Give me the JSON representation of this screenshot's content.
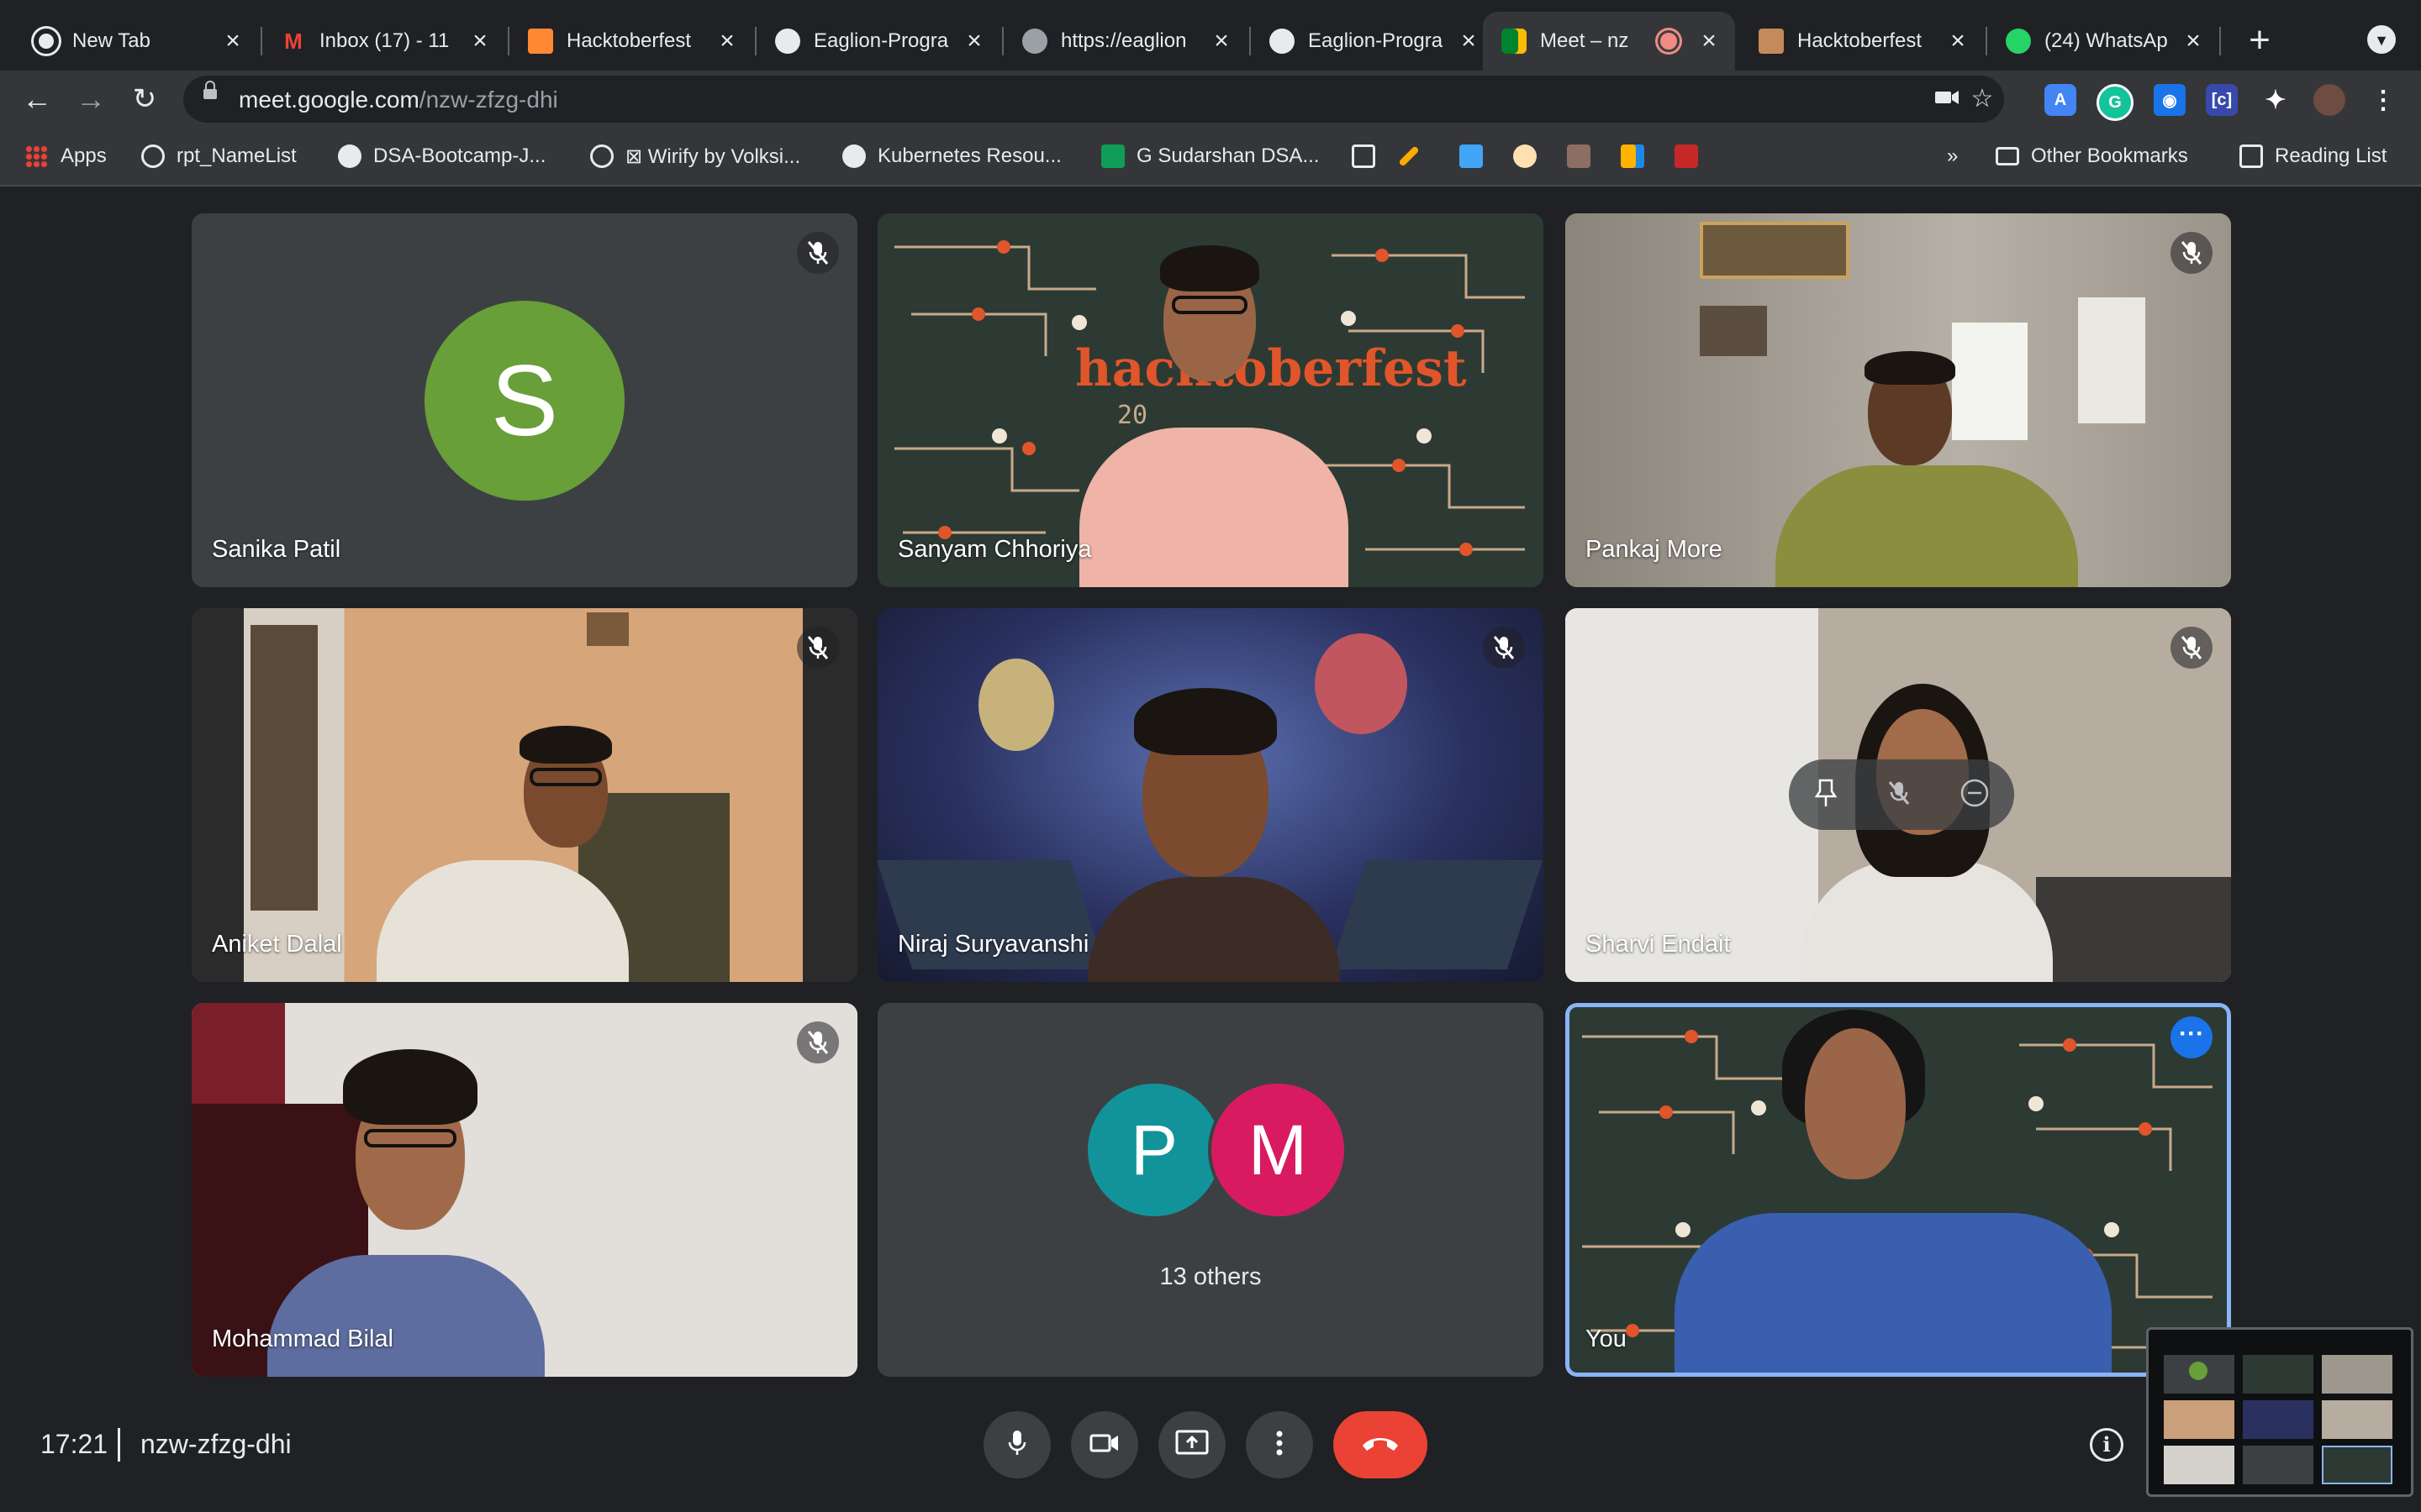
{
  "browser": {
    "tabs": [
      {
        "title": "New Tab",
        "favicon": "chrome-icon",
        "color": "#e8eaed"
      },
      {
        "title": "Inbox (17) - 11",
        "favicon": "gmail-icon",
        "color": "#ea4335"
      },
      {
        "title": "Hacktoberfest",
        "favicon": "hacktoberfest-icon",
        "color": "#ff8833"
      },
      {
        "title": "Eaglion-Progra",
        "favicon": "github-icon",
        "color": "#e8eaed"
      },
      {
        "title": "https://eaglion",
        "favicon": "globe-icon",
        "color": "#9aa0a6"
      },
      {
        "title": "Eaglion-Progra",
        "favicon": "github-icon",
        "color": "#e8eaed"
      },
      {
        "title": "Meet – nz",
        "favicon": "meet-icon",
        "color": "#00832d",
        "active": true
      },
      {
        "title": "Hacktoberfest",
        "favicon": "hacktoberfest-icon",
        "color": "#c58a5a"
      },
      {
        "title": "(24) WhatsAp",
        "favicon": "whatsapp-icon",
        "color": "#25d366"
      }
    ],
    "url_host": "meet.google.com",
    "url_path": "/nzw-zfzg-dhi",
    "bookmarks": [
      {
        "label": "Apps",
        "icon": "apps-grid-icon"
      },
      {
        "label": "rpt_NameList",
        "icon": "globe-icon"
      },
      {
        "label": "DSA-Bootcamp-J...",
        "icon": "github-icon"
      },
      {
        "label": "⊠ Wirify by Volksi...",
        "icon": "globe-icon"
      },
      {
        "label": "Kubernetes Resou...",
        "icon": "github-icon"
      },
      {
        "label": "G Sudarshan DSA...",
        "icon": "sheets-icon"
      },
      {
        "label": "Other Bookmarks",
        "icon": "folder-icon"
      },
      {
        "label": "Reading List",
        "icon": "reading-list-icon"
      }
    ],
    "overflow_label": "»"
  },
  "meet": {
    "participants": [
      {
        "name": "Sanika Patil",
        "initial": "S",
        "avatar_color": "#689f38",
        "muted": true
      },
      {
        "name": "Sanyam Chhoriya",
        "muted": false
      },
      {
        "name": "Pankaj More",
        "muted": true
      },
      {
        "name": "Aniket Dalal",
        "muted": true
      },
      {
        "name": "Niraj Suryavanshi",
        "muted": true
      },
      {
        "name": "Sharvi Endait",
        "muted": true
      },
      {
        "name": "Mohammad Bilal",
        "muted": true
      },
      {
        "name": "You",
        "muted": false
      }
    ],
    "others": {
      "label": "13 others",
      "avatars": [
        {
          "initial": "P",
          "color": "#12939a"
        },
        {
          "initial": "M",
          "color": "#d81b60"
        }
      ]
    },
    "background_text": "hacktoberfest",
    "background_year": "20",
    "time": "17:21",
    "meeting_code": "nzw-zfzg-dhi",
    "accent": "#8ab4f8",
    "end_call_color": "#ea4335"
  }
}
